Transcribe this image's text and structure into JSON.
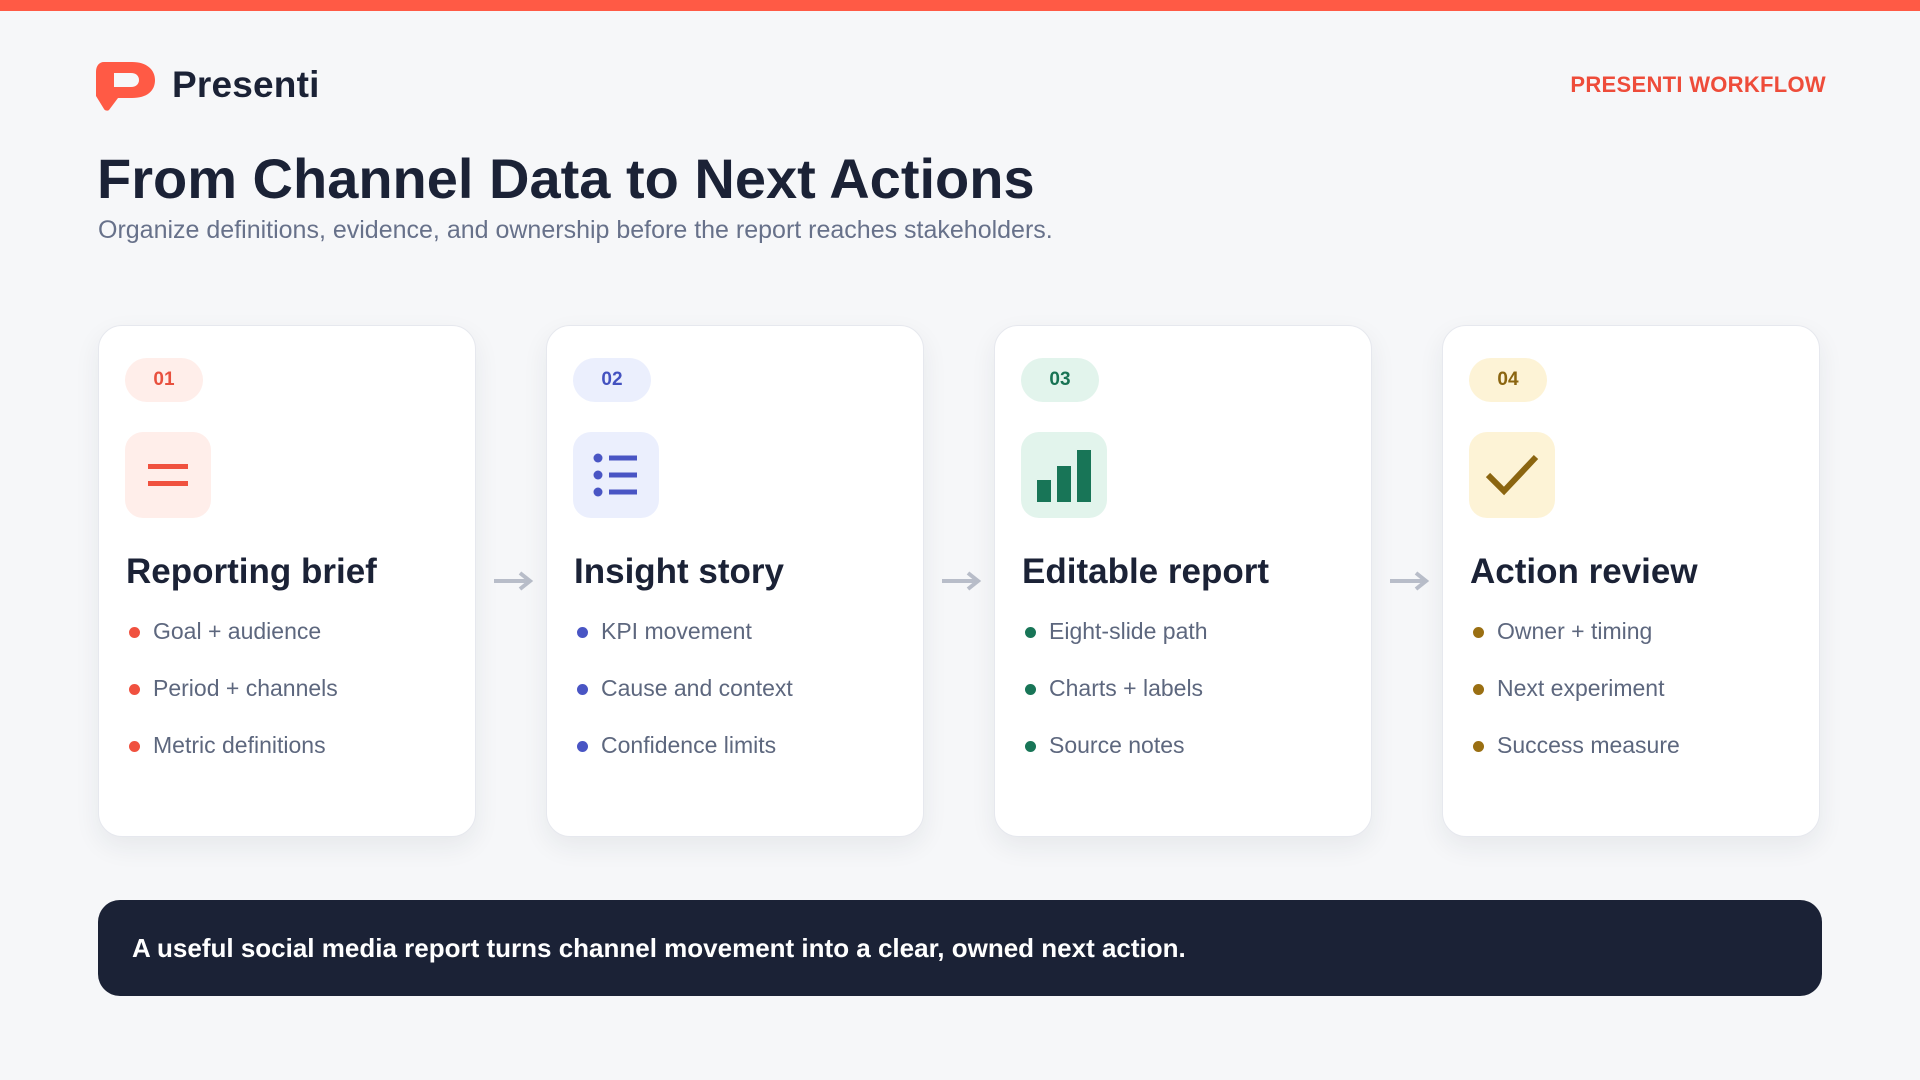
{
  "brand": {
    "name": "Presenti",
    "tag": "PRESENTI WORKFLOW",
    "accent": "#ff5a45",
    "dark": "#1b2236"
  },
  "header": {
    "title": "From Channel Data to Next Actions",
    "subtitle": "Organize definitions, evidence, and ownership before the report reaches stakeholders."
  },
  "steps": [
    {
      "number": "01",
      "icon": "menu-lines-icon",
      "title": "Reporting brief",
      "color": "#f0513f",
      "bullets": [
        "Goal + audience",
        "Period + channels",
        "Metric definitions"
      ]
    },
    {
      "number": "02",
      "icon": "list-icon",
      "title": "Insight story",
      "color": "#4955c4",
      "bullets": [
        "KPI movement",
        "Cause and context",
        "Confidence limits"
      ]
    },
    {
      "number": "03",
      "icon": "bar-chart-icon",
      "title": "Editable report",
      "color": "#187557",
      "bullets": [
        "Eight-slide path",
        "Charts + labels",
        "Source notes"
      ]
    },
    {
      "number": "04",
      "icon": "checkmark-icon",
      "title": "Action review",
      "color": "#9a6f12",
      "bullets": [
        "Owner + timing",
        "Next experiment",
        "Success measure"
      ]
    }
  ],
  "banner": {
    "text": "A useful social media report turns channel movement into a clear, owned next action."
  }
}
